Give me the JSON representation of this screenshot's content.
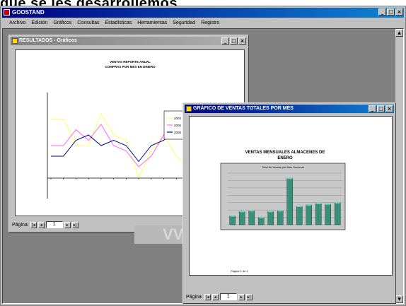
{
  "caption": "que se les desarrollemos.",
  "app": {
    "title": "GOOSTAND",
    "min_btn": "_",
    "max_btn": "□",
    "close_btn": "×",
    "menu": [
      "Archivo",
      "Edición",
      "Gráficos",
      "Consultas",
      "Estadísticas",
      "Herramientas",
      "Seguridad",
      "Registro"
    ]
  },
  "window1": {
    "title": "RESULTADOS - Gráficos",
    "chart_title": "VENTAS REPORTE ANUAL",
    "chart_subtitle": "COMPRAS POR MES EN DINERO",
    "legend": [
      "2004",
      "2005",
      "2006"
    ],
    "page_label": "Página:",
    "page_value": "1"
  },
  "window2": {
    "title": "GRÁFICO DE VENTAS TOTALES POR MES",
    "report_title_1": "VENTAS MENSUALES ALMACENES DE",
    "report_title_2": "ENERO",
    "chart_title": "Total de Ventas por Mes Sucursal",
    "footer_note": "Página 1 de 1",
    "page_label": "Página:",
    "page_value": "1"
  },
  "ghost_text": "VV",
  "colors": {
    "active_title": "#000080",
    "inactive_title": "#808080",
    "desktop": "#808080",
    "bar_fill": "#3a8f7a"
  },
  "chart_data": [
    {
      "type": "line",
      "title": "VENTAS REPORTE ANUAL",
      "x": [
        1,
        2,
        3,
        4,
        5,
        6,
        7,
        8,
        9,
        10,
        11,
        12
      ],
      "series": [
        {
          "name": "2004",
          "values": [
            110,
            110,
            60,
            60,
            120,
            80,
            70,
            0,
            50,
            80,
            40,
            20
          ],
          "color": "#ffff66"
        },
        {
          "name": "2005",
          "values": [
            60,
            60,
            90,
            70,
            100,
            60,
            50,
            20,
            40,
            80,
            100,
            90
          ],
          "color": "#ff66ff"
        },
        {
          "name": "2006",
          "values": [
            40,
            40,
            70,
            80,
            60,
            70,
            60,
            30,
            60,
            70,
            90,
            80
          ],
          "color": "#00008b"
        }
      ],
      "ylim": [
        -40,
        160
      ]
    },
    {
      "type": "bar",
      "title": "Total de Ventas por Mes Sucursal",
      "categories": [
        "1",
        "2",
        "3",
        "4",
        "5",
        "6",
        "7",
        "8",
        "9",
        "10",
        "11",
        "12"
      ],
      "values": [
        120,
        180,
        190,
        100,
        180,
        190,
        630,
        250,
        270,
        290,
        280,
        300
      ],
      "ylim": [
        0,
        700
      ]
    }
  ]
}
